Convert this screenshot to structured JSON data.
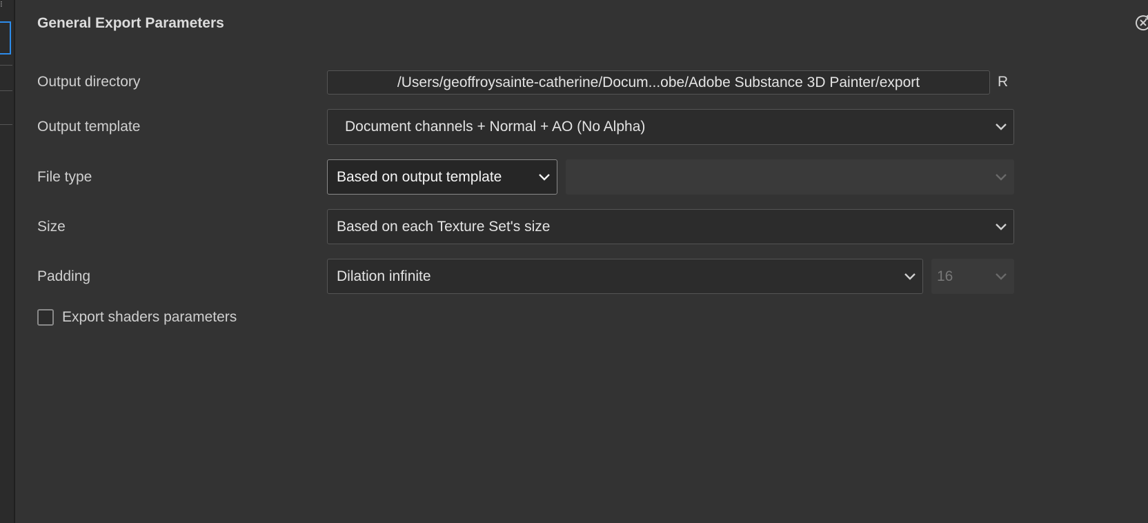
{
  "panel": {
    "title": "General Export Parameters"
  },
  "fields": {
    "output_directory": {
      "label": "Output directory",
      "value": "/Users/geoffroysainte-catherine/Docum...obe/Adobe Substance 3D Painter/export",
      "suffix": "R"
    },
    "output_template": {
      "label": "Output template",
      "value": "Document channels + Normal + AO (No Alpha)"
    },
    "file_type": {
      "label": "File type",
      "value": "Based on output template",
      "secondary_value": ""
    },
    "size": {
      "label": "Size",
      "value": "Based on each Texture Set's size"
    },
    "padding": {
      "label": "Padding",
      "value": "Dilation infinite",
      "secondary_value": "16"
    },
    "export_shaders": {
      "label": "Export shaders parameters",
      "checked": false
    }
  },
  "icons": {
    "chevron": "chevron-down-icon",
    "reset": "reset-icon"
  },
  "colors": {
    "background": "#333333",
    "accent": "#2d8ceb"
  }
}
